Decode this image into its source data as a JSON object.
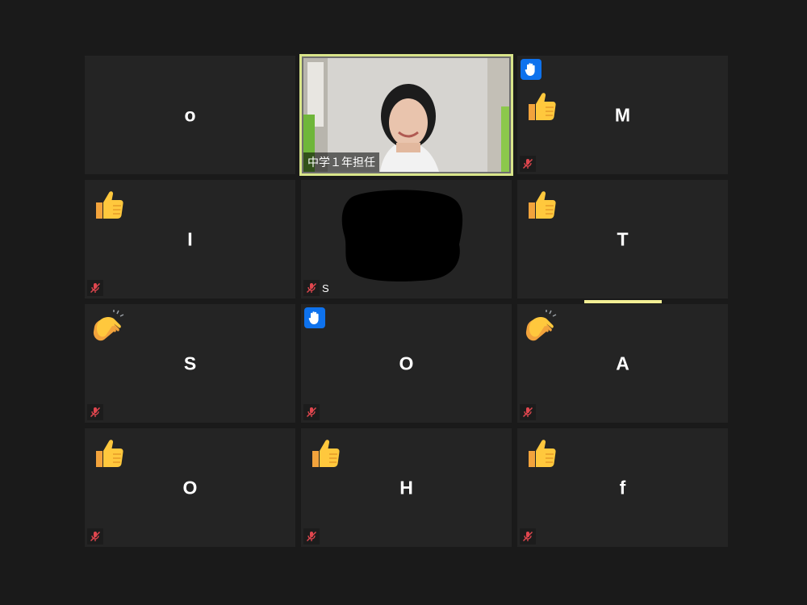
{
  "meeting": {
    "tiles": [
      {
        "name": "o",
        "muted": false,
        "raised_hand": false,
        "reaction": ""
      },
      {
        "name": "中学１年担任",
        "muted": false,
        "video": true,
        "speaking": true
      },
      {
        "name": "M",
        "muted": true,
        "raised_hand": true,
        "reaction": "thumbs-up"
      },
      {
        "name": "I",
        "muted": true,
        "raised_hand": false,
        "reaction": "thumbs-up"
      },
      {
        "name": "S",
        "muted": true,
        "redacted": true
      },
      {
        "name": "T",
        "muted": false,
        "raised_hand": false,
        "reaction": "thumbs-up",
        "active": true
      },
      {
        "name": "S",
        "muted": true,
        "raised_hand": false,
        "reaction": "clapping-hands"
      },
      {
        "name": "O",
        "muted": true,
        "raised_hand": true,
        "reaction": ""
      },
      {
        "name": "A",
        "muted": true,
        "raised_hand": false,
        "reaction": "clapping-hands"
      },
      {
        "name": "O",
        "muted": true,
        "raised_hand": false,
        "reaction": "thumbs-up"
      },
      {
        "name": "H",
        "muted": true,
        "raised_hand": false,
        "reaction": "thumbs-up"
      },
      {
        "name": "f",
        "muted": true,
        "raised_hand": false,
        "reaction": "thumbs-up"
      }
    ],
    "colors": {
      "background": "#1a1a1a",
      "tile": "#242424",
      "speaking_border": "#d9e58a",
      "raise_hand": "#0e72ed",
      "muted_icon": "#e0464e",
      "active_bar": "#f3ef95"
    },
    "icons": {
      "muted": "microphone-muted-icon",
      "raise_hand": "raised-hand-icon",
      "thumbs_up": "thumbs-up-icon",
      "clap": "clapping-hands-icon"
    }
  }
}
